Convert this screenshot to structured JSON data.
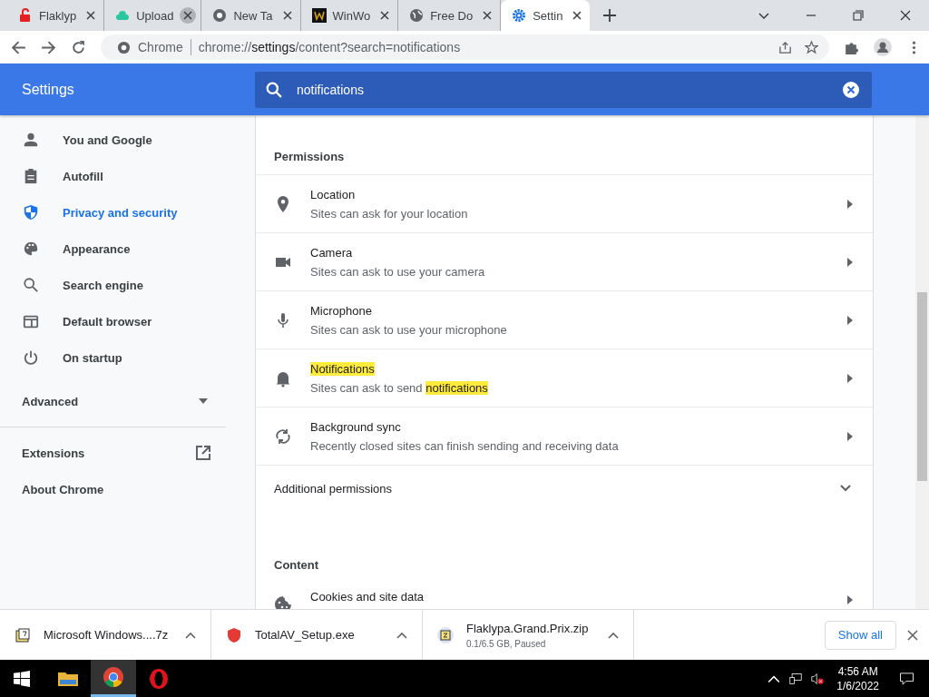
{
  "tabs": [
    {
      "title": "Flaklyp",
      "kind": "lock",
      "selected": false,
      "hovered": false
    },
    {
      "title": "Upload",
      "kind": "cloud",
      "selected": false,
      "hovered": true
    },
    {
      "title": "New Ta",
      "kind": "chrome",
      "selected": false,
      "hovered": false
    },
    {
      "title": "WinWo",
      "kind": "w",
      "selected": false,
      "hovered": false
    },
    {
      "title": "Free Do",
      "kind": "globe",
      "selected": false,
      "hovered": false
    },
    {
      "title": "Settin",
      "kind": "gear",
      "selected": true,
      "hovered": false
    }
  ],
  "toolbar": {
    "site_label": "Chrome",
    "url_prefix": "chrome://",
    "url_host": "settings",
    "url_rest": "/content?search=notifications"
  },
  "header": {
    "title": "Settings",
    "search_value": "notifications"
  },
  "sidebar": {
    "items": [
      {
        "label": "You and Google",
        "kind": "person",
        "selected": false
      },
      {
        "label": "Autofill",
        "kind": "clipboard",
        "selected": false
      },
      {
        "label": "Privacy and security",
        "kind": "shield",
        "selected": true
      },
      {
        "label": "Appearance",
        "kind": "palette",
        "selected": false
      },
      {
        "label": "Search engine",
        "kind": "search",
        "selected": false
      },
      {
        "label": "Default browser",
        "kind": "browser",
        "selected": false
      },
      {
        "label": "On startup",
        "kind": "power",
        "selected": false
      }
    ],
    "advanced": {
      "label": "Advanced",
      "expanded": false
    },
    "links": [
      {
        "label": "Extensions",
        "external": true
      },
      {
        "label": "About Chrome",
        "external": false
      }
    ]
  },
  "permissions": {
    "heading": "Permissions",
    "rows": [
      {
        "kind": "pin",
        "title": "Location",
        "title_highlighted": false,
        "subtitle_parts": [
          {
            "text": "Sites can ask for your location",
            "highlighted": false
          }
        ]
      },
      {
        "kind": "camera",
        "title": "Camera",
        "title_highlighted": false,
        "subtitle_parts": [
          {
            "text": "Sites can ask to use your camera",
            "highlighted": false
          }
        ]
      },
      {
        "kind": "mic",
        "title": "Microphone",
        "title_highlighted": false,
        "subtitle_parts": [
          {
            "text": "Sites can ask to use your microphone",
            "highlighted": false
          }
        ]
      },
      {
        "kind": "bell",
        "title": "Notifications",
        "title_highlighted": true,
        "subtitle_parts": [
          {
            "text": "Sites can ask to send ",
            "highlighted": false
          },
          {
            "text": "notifications",
            "highlighted": true
          }
        ]
      },
      {
        "kind": "sync",
        "title": "Background sync",
        "title_highlighted": false,
        "subtitle_parts": [
          {
            "text": "Recently closed sites can finish sending and receiving data",
            "highlighted": false
          }
        ]
      }
    ],
    "additional": {
      "label": "Additional permissions",
      "expanded": false
    }
  },
  "content": {
    "heading": "Content",
    "rows": [
      {
        "kind": "cookie",
        "title": "Cookies and site data"
      }
    ]
  },
  "downloads": {
    "items": [
      {
        "kind": "archive",
        "name": "Microsoft Windows....7z"
      },
      {
        "kind": "shield",
        "name": "TotalAV_Setup.exe"
      },
      {
        "kind": "zip",
        "name": "Flaklypa.Grand.Prix.zip",
        "status": "0.1/6.5 GB, Paused"
      }
    ],
    "show_all": "Show all"
  },
  "taskbar": {
    "apps": [
      {
        "kind": "folder",
        "active": false
      },
      {
        "kind": "chrome",
        "active": true
      },
      {
        "kind": "opera",
        "active": false
      }
    ],
    "time": "4:56 AM",
    "date": "1/6/2022"
  }
}
